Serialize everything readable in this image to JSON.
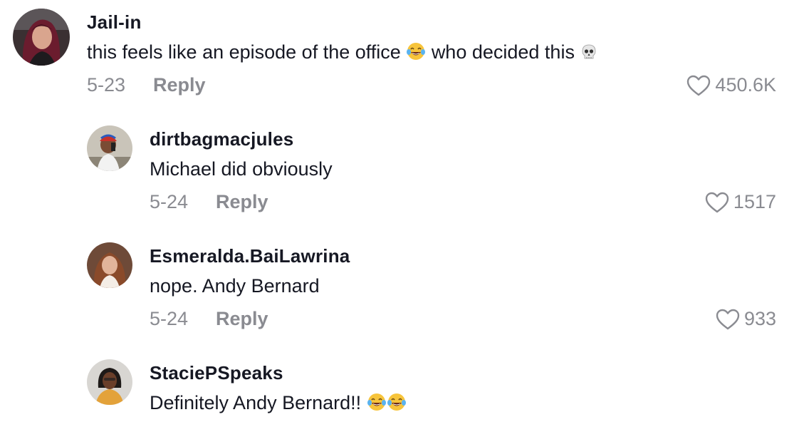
{
  "comments": [
    {
      "username": "Jail-in",
      "text_before": "this feels like an episode of the office",
      "emoji_1": "face-with-tears-of-joy",
      "text_after": "who decided this",
      "emoji_2": "skull",
      "date": "5-23",
      "reply_label": "Reply",
      "likes": "450.6K"
    },
    {
      "username": "dirtbagmacjules",
      "text": "Michael did obviously",
      "date": "5-24",
      "reply_label": "Reply",
      "likes": "1517"
    },
    {
      "username": "Esmeralda.BaiLawrina",
      "text": "nope. Andy Bernard",
      "date": "5-24",
      "reply_label": "Reply",
      "likes": "933"
    },
    {
      "username": "StaciePSpeaks",
      "text": "Definitely Andy Bernard!!",
      "emoji": "face-with-tears-of-joy x2"
    }
  ],
  "colors": {
    "primary_text": "#161823",
    "secondary_text": "#8a8b91"
  }
}
